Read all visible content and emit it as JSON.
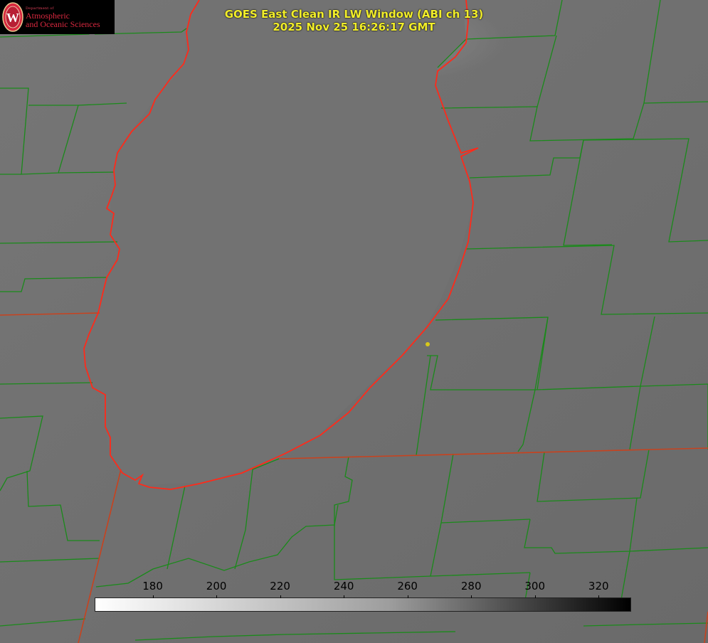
{
  "title": {
    "line1": "GOES East Clean IR LW Window (ABI ch 13)",
    "line2": "2025 Nov 25 16:26:17 GMT"
  },
  "logo": {
    "dept": "Department of",
    "line1": "Atmospheric",
    "line2": "and Oceanic Sciences",
    "seal_letter": "W"
  },
  "colorbar": {
    "min": 162,
    "max": 330,
    "ticks": [
      "180",
      "200",
      "220",
      "240",
      "260",
      "280",
      "300",
      "320"
    ],
    "gradient": [
      "#ffffff",
      "#9d9d9d",
      "#000000"
    ]
  },
  "colors": {
    "county_lines": "#1a8a1a",
    "state_lines": "#c8421e",
    "coastline": "#ff2a1a",
    "title_text": "#f2ee2a",
    "marker": "#d8c81a"
  },
  "marker": {
    "name": "yellow-dot"
  }
}
